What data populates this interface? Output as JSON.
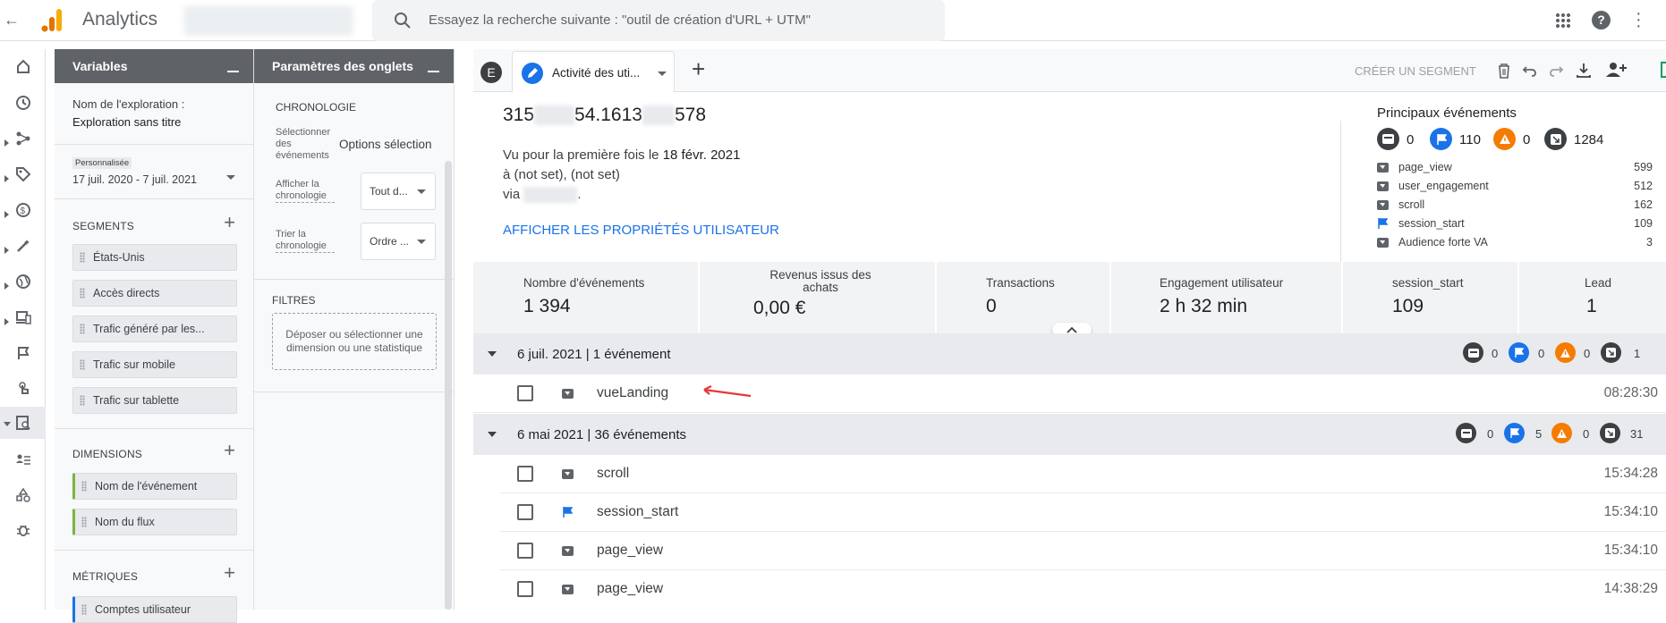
{
  "topbar": {
    "app_title": "Analytics",
    "search_placeholder": "Essayez la recherche suivante : \"outil de création d'URL + UTM\""
  },
  "variables": {
    "title": "Variables",
    "exploration_label": "Nom de l'exploration :",
    "exploration_name": "Exploration sans titre",
    "date_badge": "Personnalisée",
    "date_range": "17 juil. 2020 - 7 juil. 2021",
    "segments_header": "SEGMENTS",
    "segments": [
      "États-Unis",
      "Accès directs",
      "Trafic généré par les...",
      "Trafic sur mobile",
      "Trafic sur tablette"
    ],
    "dimensions_header": "DIMENSIONS",
    "dimensions": [
      "Nom de l'événement",
      "Nom du flux"
    ],
    "metrics_header": "MÉTRIQUES",
    "metrics": [
      "Comptes utilisateur"
    ]
  },
  "tab_settings": {
    "title": "Paramètres des onglets",
    "section": "CHRONOLOGIE",
    "select_events_label": "Sélectionner des événements",
    "select_events_value": "Options sélection",
    "show_timeline_label": "Afficher la chronologie",
    "show_timeline_value": "Tout d...",
    "sort_timeline_label": "Trier la chronologie",
    "sort_timeline_value": "Ordre ...",
    "filters_header": "FILTRES",
    "filters_drop": "Déposer ou sélectionner une dimension ou une statistique"
  },
  "tabs": {
    "avatar_letter": "E",
    "active_tab": "Activité des uti...",
    "create_segment": "CRÉER UN SEGMENT"
  },
  "user": {
    "id_a": "315",
    "id_b": "54.1613",
    "id_c": "578",
    "first_seen_prefix": "Vu pour la première fois le ",
    "first_seen_date": "18 févr. 2021",
    "location": "à (not set), (not set)",
    "via_prefix": "via ",
    "via_end": ".",
    "show_props": "AFFICHER LES PROPRIÉTÉS UTILISATEUR"
  },
  "top_events": {
    "title": "Principaux événements",
    "counts": [
      "0",
      "110",
      "0",
      "1284"
    ],
    "items": [
      {
        "name": "page_view",
        "count": "599",
        "icon": "event-icon"
      },
      {
        "name": "user_engagement",
        "count": "512",
        "icon": "event-icon"
      },
      {
        "name": "scroll",
        "count": "162",
        "icon": "event-icon"
      },
      {
        "name": "session_start",
        "count": "109",
        "icon": "flag-icon"
      },
      {
        "name": "Audience forte VA",
        "count": "3",
        "icon": "event-icon"
      }
    ]
  },
  "kpis": [
    {
      "label": "Nombre d'événements",
      "value": "1 394"
    },
    {
      "label": "Revenus issus des achats",
      "value": "0,00 €"
    },
    {
      "label": "Transactions",
      "value": "0"
    },
    {
      "label": "Engagement utilisateur",
      "value": "2 h 32 min"
    },
    {
      "label": "session_start",
      "value": "109"
    },
    {
      "label": "Lead",
      "value": "1"
    }
  ],
  "groups": [
    {
      "title": "6 juil. 2021 | 1 événement",
      "counts": [
        "0",
        "0",
        "0",
        "1"
      ],
      "rows": [
        {
          "event": "vueLanding",
          "time": "08:28:30",
          "icon": "event-icon"
        }
      ]
    },
    {
      "title": "6 mai 2021 | 36 événements",
      "counts": [
        "0",
        "5",
        "0",
        "31"
      ],
      "rows": [
        {
          "event": "scroll",
          "time": "15:34:28",
          "icon": "event-icon"
        },
        {
          "event": "session_start",
          "time": "15:34:10",
          "icon": "flag-icon"
        },
        {
          "event": "page_view",
          "time": "15:34:10",
          "icon": "event-icon"
        },
        {
          "event": "page_view",
          "time": "14:38:29",
          "icon": "event-icon"
        }
      ]
    }
  ],
  "colors": {
    "accent": "#1a73e8",
    "header_gray": "#5f6368",
    "warning": "#f57c00",
    "dark": "#3c4043"
  }
}
